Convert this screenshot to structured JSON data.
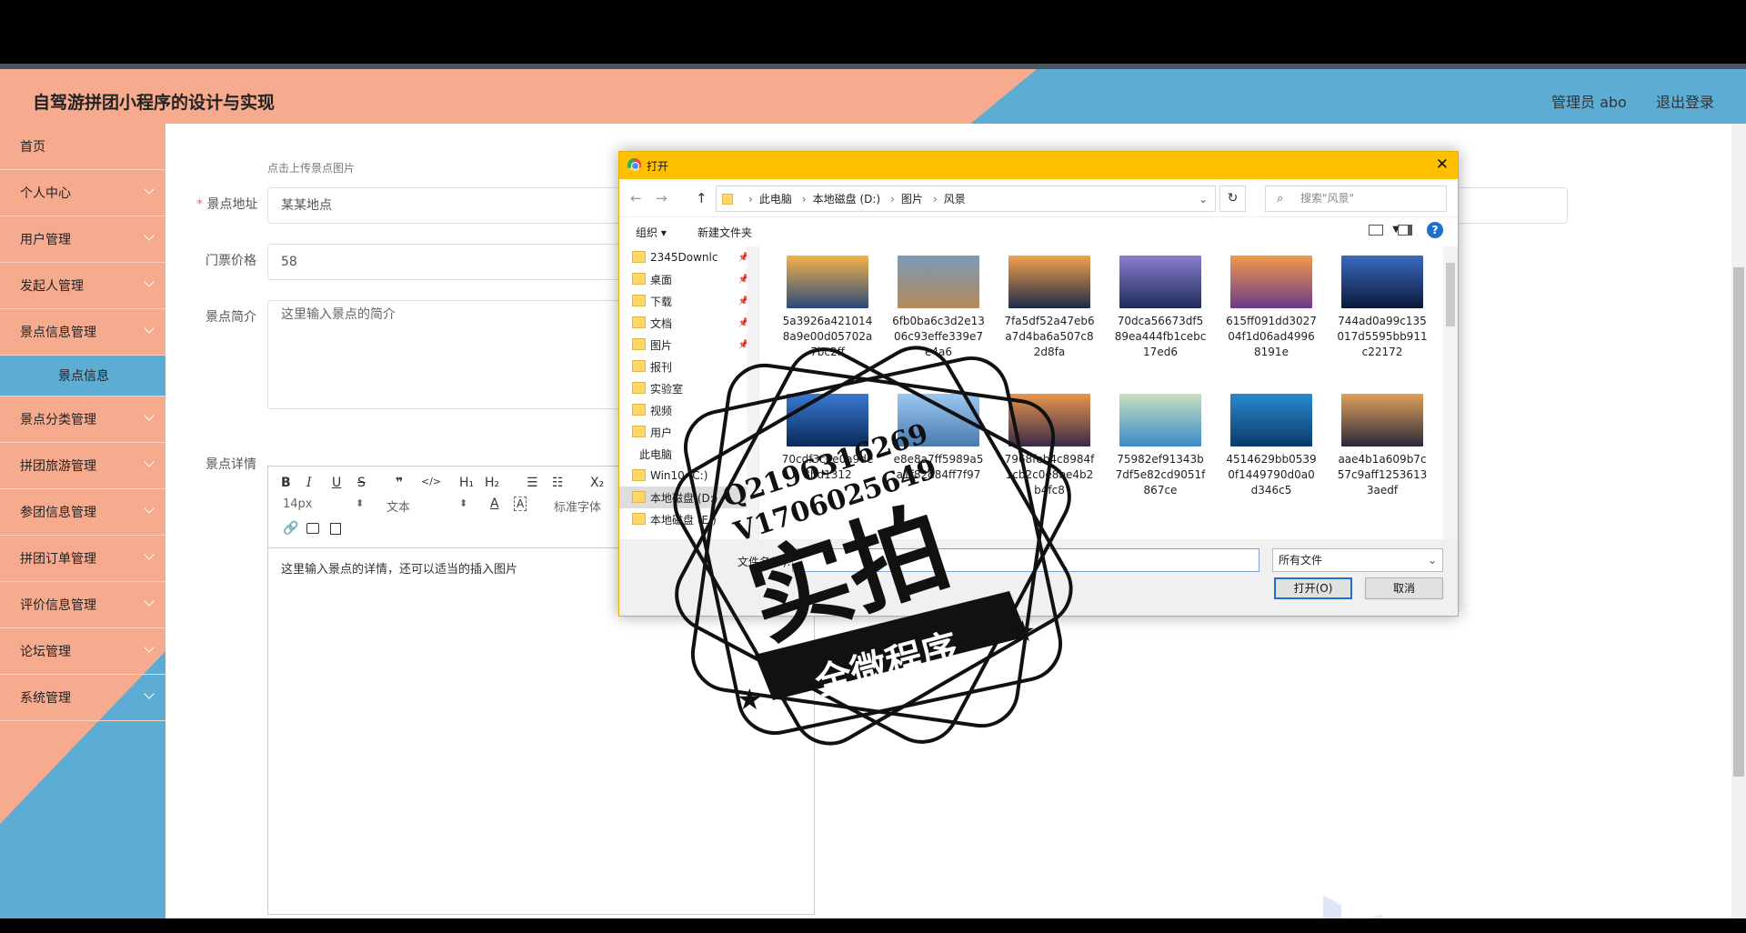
{
  "app": {
    "title": "自驾游拼团小程序的设计与实现",
    "admin": "管理员 abo",
    "logout": "退出登录"
  },
  "sidebar": {
    "items": [
      {
        "label": "首页",
        "chev": false
      },
      {
        "label": "个人中心",
        "chev": true
      },
      {
        "label": "用户管理",
        "chev": true
      },
      {
        "label": "发起人管理",
        "chev": true
      },
      {
        "label": "景点信息管理",
        "chev": true
      },
      {
        "label": "景点信息",
        "sub": true
      },
      {
        "label": "景点分类管理",
        "chev": true
      },
      {
        "label": "拼团旅游管理",
        "chev": true
      },
      {
        "label": "参团信息管理",
        "chev": true
      },
      {
        "label": "拼团订单管理",
        "chev": true
      },
      {
        "label": "评价信息管理",
        "chev": true
      },
      {
        "label": "论坛管理",
        "chev": true
      },
      {
        "label": "系统管理",
        "chev": true
      }
    ]
  },
  "form": {
    "upload_hint": "点击上传景点图片",
    "address_label": "景点地址",
    "address_value": "某某地点",
    "price_label": "门票价格",
    "price_value": "58",
    "intro_label": "景点简介",
    "intro_placeholder": "这里输入景点的简介",
    "detail_label": "景点详情",
    "editor_body": "这里输入景点的详情，还可以适当的插入图片"
  },
  "editor_toolbar": {
    "font_size": "14px",
    "block": "文本",
    "font_family": "标准字体",
    "h1": "H₁",
    "h2": "H₂",
    "quote": "❞",
    "code": "</>",
    "sub": "X₂"
  },
  "dialog": {
    "title": "打开",
    "breadcrumb": [
      "此电脑",
      "本地磁盘 (D:)",
      "图片",
      "风景"
    ],
    "search_placeholder": "搜索\"风景\"",
    "organize": "组织 ▾",
    "new_folder": "新建文件夹",
    "tree": [
      {
        "label": "2345Downlc",
        "pin": true
      },
      {
        "label": "桌面",
        "pin": true
      },
      {
        "label": "下载",
        "pin": true
      },
      {
        "label": "文档",
        "pin": true
      },
      {
        "label": "图片",
        "pin": true
      },
      {
        "label": "报刊"
      },
      {
        "label": "实验室"
      },
      {
        "label": "视频"
      },
      {
        "label": "用户"
      },
      {
        "label": "此电脑",
        "top": true
      },
      {
        "label": "Win10 (C:)",
        "drive": false
      },
      {
        "label": "本地磁盘 (D:)",
        "drive": true
      },
      {
        "label": "本地磁盘 (E:)"
      }
    ],
    "files": [
      {
        "name": "5a3926a4210148a9e00d05702a7bc2ff",
        "colors": [
          "#f5b34a",
          "#2a4a7a"
        ]
      },
      {
        "name": "6fb0ba6c3d2e1306c93effe339e7e4a6",
        "colors": [
          "#7a9ab5",
          "#b78a5a"
        ]
      },
      {
        "name": "7fa5df52a47eb6a7d4ba6a507c82d8fa",
        "colors": [
          "#f4a24a",
          "#1c2a4a"
        ]
      },
      {
        "name": "70dca56673df589ea444fb1cebc17ed6",
        "colors": [
          "#8a7ed0",
          "#1e2c5a"
        ]
      },
      {
        "name": "615ff091dd302704f1d06ad49968191e",
        "colors": [
          "#f09a4a",
          "#6a3a8a"
        ]
      },
      {
        "name": "744ad0a99c135017d5595bb911c22172",
        "colors": [
          "#3c6ac0",
          "#0a1a3a"
        ]
      },
      {
        "name": "70cdf3c0e0a9de8bd1312",
        "colors": [
          "#3a7ad0",
          "#0a2a5a"
        ]
      },
      {
        "name": "e8e8a7ff5989a5a1f82d84ff7f97",
        "colors": [
          "#9ac8f0",
          "#4a7ab0"
        ]
      },
      {
        "name": "7968feb4c8984f1cb2c0e8be4b2b4fc8",
        "colors": [
          "#e8944a",
          "#3a2a4a"
        ]
      },
      {
        "name": "75982ef91343b7df5e82cd9051f867ce",
        "colors": [
          "#c8e0c0",
          "#3a8ac8"
        ]
      },
      {
        "name": "4514629bb05390f1449790d0a0d346c5",
        "colors": [
          "#2a8ad0",
          "#0a3a6a"
        ]
      },
      {
        "name": "aae4b1a609b7c57c9aff12536133aedf",
        "colors": [
          "#e0a05a",
          "#2a2a3a"
        ]
      }
    ],
    "filename_label": "文件名(N):",
    "filter": "所有文件",
    "open_button": "打开(O)",
    "cancel_button": "取消"
  },
  "stamp": {
    "line1": "Q2196316269",
    "line2": "V1706025649",
    "big": "实拍",
    "banner": "全微程序"
  },
  "colors": {
    "peach": "#f6ab8e",
    "blue": "#5dacd3",
    "dialog_title": "#ffc000"
  }
}
